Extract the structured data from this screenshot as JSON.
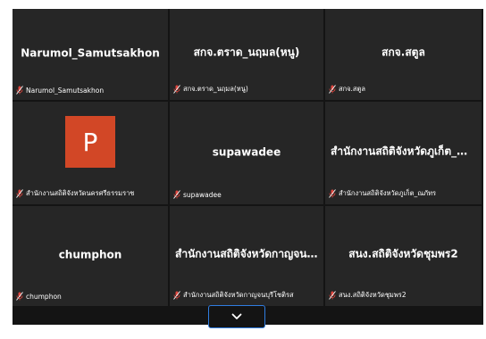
{
  "tiles": [
    {
      "name": "Narumol_Samutsakhon",
      "label": "Narumol_Samutsakhon"
    },
    {
      "name": "สกจ.ตราด_นฤมล(หนู)",
      "label": "สกจ.ตราด_นฤมล(หนู)"
    },
    {
      "name": "สกจ.สตูล",
      "label": "สกจ.สตูล"
    },
    {
      "name": "",
      "avatar_letter": "P",
      "label": "สำนักงานสถิติจังหวัดนครศรีธรรมราช"
    },
    {
      "name": "supawadee",
      "label": "supawadee"
    },
    {
      "name": "สำนักงานสถิติจังหวัดภูเก็ต_ณ...",
      "label": "สำนักงานสถิติจังหวัดภูเก็ต_ณภัทร"
    },
    {
      "name": "chumphon",
      "label": "chumphon"
    },
    {
      "name": "สำนักงานสถิติจังหวัดกาญจน...",
      "label": "สำนักงานสถิติจังหวัดกาญจนบุรีโชติรส"
    },
    {
      "name": "สนง.สถิติจังหวัดชุมพร2",
      "label": "สนง.สถิติจังหวัดชุมพร2"
    }
  ],
  "colors": {
    "tile_bg": "#262626",
    "mic_off": "#e0463e",
    "avatar_ppt": "#d24726",
    "accent": "#2f7de1"
  },
  "icons": {
    "mic": "mic-off-icon",
    "expand": "chevron-down-icon"
  }
}
